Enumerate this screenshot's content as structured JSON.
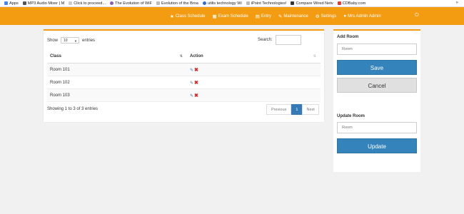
{
  "bookmarks": [
    {
      "label": "Apps",
      "color": "#4285f4"
    },
    {
      "label": "MP3 Audio Mixer | M",
      "color": "#555555"
    },
    {
      "label": "Click to proceed...",
      "color": "#cccccc"
    },
    {
      "label": "The Evolution of WiF",
      "color": "#8e5bb5"
    },
    {
      "label": "Evolution of the Broa",
      "color": "#bdbdbd"
    },
    {
      "label": "utilis technology Wi",
      "color": "#2a6fd6"
    },
    {
      "label": "iPoint Technologies\\",
      "color": "#bdbdbd"
    },
    {
      "label": "Compare Wired Netv",
      "color": "#333333"
    },
    {
      "label": "CDBaby.com",
      "color": "#e53935"
    }
  ],
  "bookmarks_more": "»",
  "nav": {
    "items": [
      {
        "icon": "★",
        "label": "Class Schedule"
      },
      {
        "icon": "▦",
        "label": "Exam Schedule"
      },
      {
        "icon": "▤",
        "label": "Entry"
      },
      {
        "icon": "✎",
        "label": "Maintenance"
      },
      {
        "icon": "⚙",
        "label": "Settings"
      },
      {
        "icon": "●",
        "label": "Mrs Admin Admin"
      }
    ],
    "power_icon": "⏻"
  },
  "table_panel": {
    "show_label": "Show",
    "entries_value": "10",
    "entries_label": "entries",
    "search_label": "Search:",
    "columns": [
      "Class",
      "Action"
    ],
    "rows": [
      "Room 101",
      "Room 102",
      "Room 103"
    ],
    "info": "Showing 1 to 3 of 3 entries",
    "pager": {
      "previous": "Previous",
      "page": "1",
      "next": "Next"
    }
  },
  "side_panel": {
    "add_title": "Add Room",
    "add_placeholder": "Room",
    "save_label": "Save",
    "cancel_label": "Cancel",
    "update_title": "Update Room",
    "update_placeholder": "Room",
    "update_label": "Update"
  },
  "colors": {
    "accent": "#f39c12",
    "primary": "#3483bb",
    "delete": "#d9251d"
  }
}
